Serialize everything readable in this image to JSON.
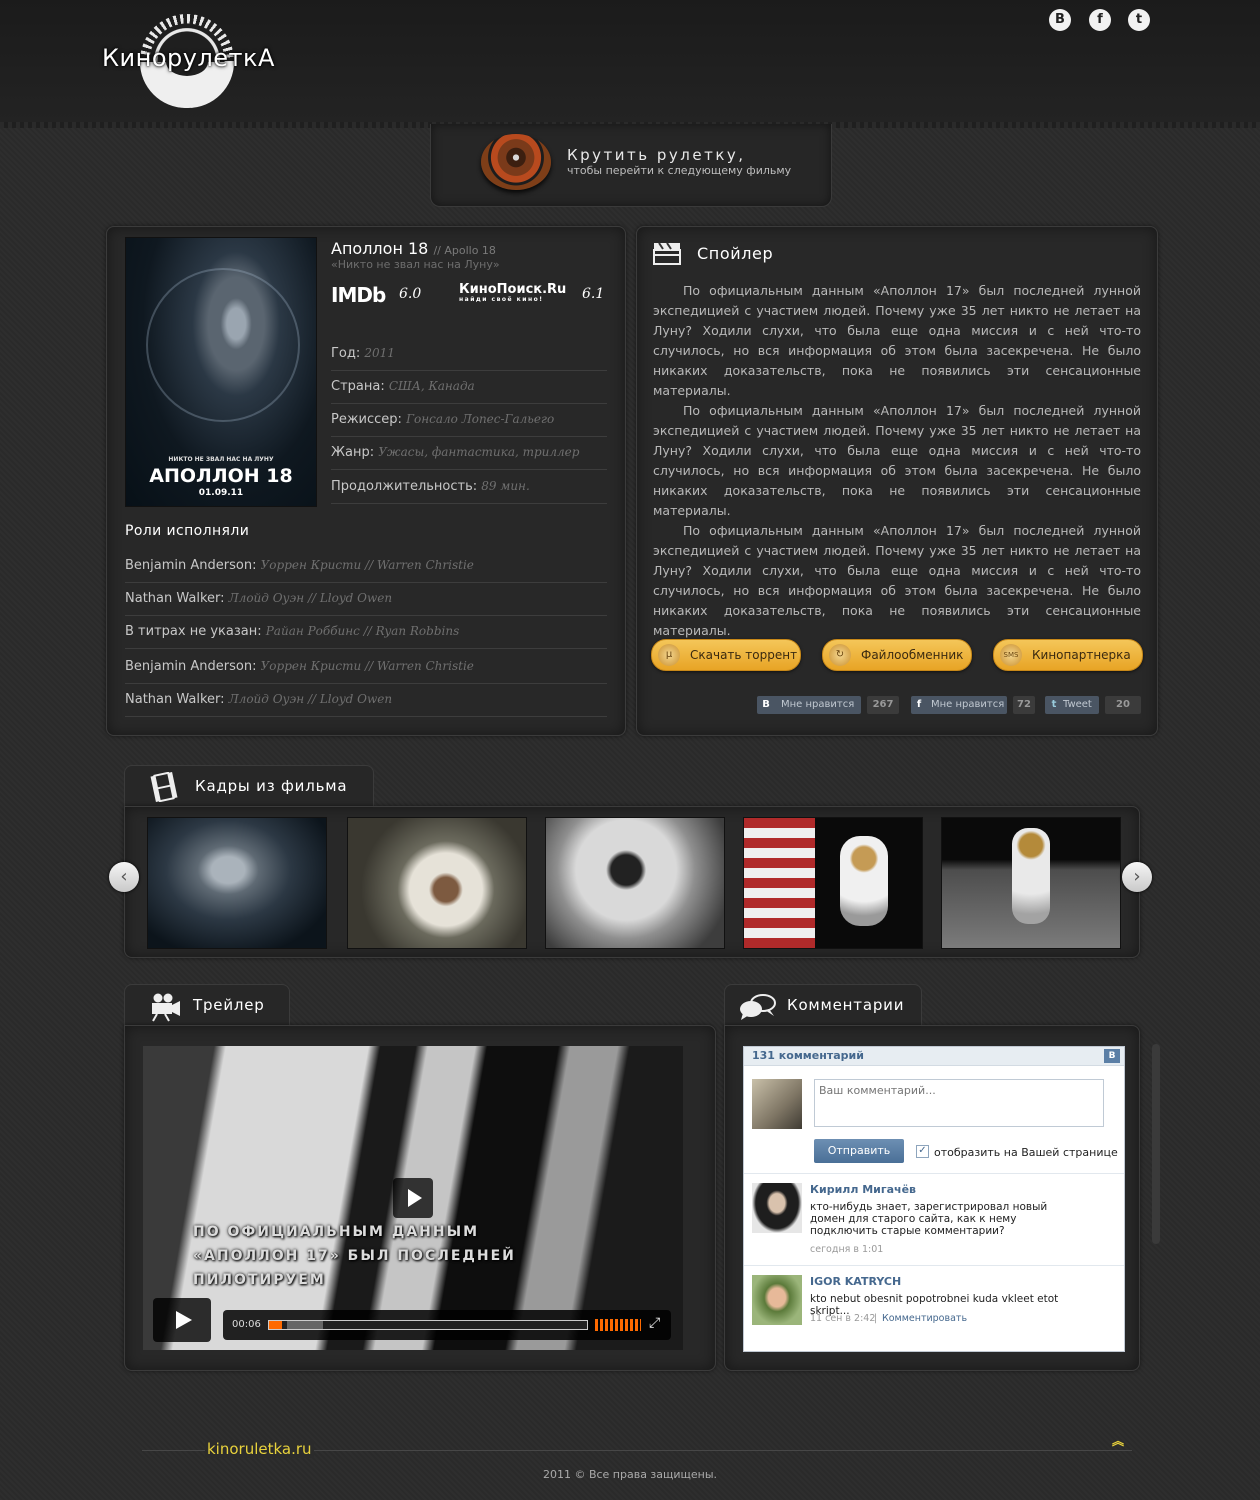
{
  "header": {
    "logo_text": "КинорулеткА",
    "social": [
      {
        "label": "В",
        "icon": "vk-icon"
      },
      {
        "label": "f",
        "icon": "facebook-icon"
      },
      {
        "label": "t",
        "icon": "twitter-icon"
      }
    ]
  },
  "roulette": {
    "title": "Крутить рулетку,",
    "subtitle": "чтобы перейти к следующему фильму"
  },
  "movie": {
    "title": "Аполлон 18",
    "original_title": "// Apollo 18",
    "tagline": "«Никто не звал нас на Луну»",
    "poster": {
      "tagline": "НИКТО НЕ ЗВАЛ НАС НА ЛУНУ",
      "title": "АПОЛЛОН 18",
      "date": "01.09.11"
    },
    "ratings": {
      "imdb_label": "IMDb",
      "imdb_value": "6.0",
      "kp_label": "КиноПоиск.Ru",
      "kp_sub": "найди своё кино!",
      "kp_value": "6.1"
    },
    "info": [
      {
        "label": "Год:",
        "value": "2011"
      },
      {
        "label": "Страна:",
        "value": "США, Канада"
      },
      {
        "label": "Режиссер:",
        "value": "Гонсало Лопес-Гальего"
      },
      {
        "label": "Жанр:",
        "value": "Ужасы, фантастика, триллер"
      },
      {
        "label": "Продолжительность:",
        "value": "89 мин."
      }
    ],
    "roles_title": "Роли исполняли",
    "cast": [
      {
        "role": "Benjamin Anderson:",
        "actor": "Уоррен Кристи // Warren Christie"
      },
      {
        "role": "Nathan Walker:",
        "actor": "Ллойд Оуэн // Lloyd Owen"
      },
      {
        "role": "В титрах не указан:",
        "actor": "Райан Роббинс // Ryan Robbins"
      },
      {
        "role": "Benjamin Anderson:",
        "actor": "Уоррен Кристи // Warren Christie"
      },
      {
        "role": "Nathan Walker:",
        "actor": "Ллойд Оуэн // Lloyd Owen"
      }
    ]
  },
  "spoiler": {
    "title": "Спойлер",
    "paragraphs": [
      "По официальным данным «Аполлон 17» был последней лунной экспедицией с участием людей. Почему уже 35 лет никто не летает на Луну? Ходили слухи, что была еще одна миссия и с ней что-то случилось, но вся информация об этом была засекречена. Не было никаких доказательств, пока не появились эти сенсационные материалы.",
      "По официальным данным «Аполлон 17» был последней лунной экспедицией с участием людей. Почему уже 35 лет никто не летает на Луну? Ходили слухи, что была еще одна миссия и с ней что-то случилось, но вся информация об этом была засекречена. Не было никаких доказательств, пока не появились эти сенсационные материалы.",
      "По официальным данным «Аполлон 17» был последней лунной экспедицией с участием людей. Почему уже 35 лет никто не летает на Луну? Ходили слухи, что была еще одна миссия и с ней что-то случилось, но вся информация об этом была засекречена. Не было никаких доказательств, пока не появились эти сенсационные материалы."
    ],
    "buttons": [
      {
        "label": "Скачать торрент",
        "icon": "torrent-icon"
      },
      {
        "label": "Файлообменник",
        "icon": "download-arrow-icon"
      },
      {
        "label": "Кинопартнерка",
        "icon": "sms-icon",
        "icon_text": "SMS"
      }
    ],
    "likes": [
      {
        "brand": "В",
        "label": "Мне нравится",
        "count": "267"
      },
      {
        "brand": "f",
        "label": "Мне нравится",
        "count": "72"
      },
      {
        "brand": "t",
        "label": "Tweet",
        "count": "20"
      }
    ]
  },
  "frames": {
    "title": "Кадры из фильма",
    "prev": "‹",
    "next": "›"
  },
  "trailer": {
    "title": "Трейлер",
    "subtitle_lines": [
      "ПО ОФИЦИАЛЬНЫМ ДАННЫМ",
      "«АПОЛЛОН 17» БЫЛ ПОСЛЕДНЕЙ",
      "ПИЛОТИРУЕМ"
    ],
    "time": "00:06",
    "progress": 0.04,
    "fullscreen_icon": "⤢"
  },
  "comments": {
    "title": "Комментарии",
    "count": "131 комментарий",
    "vk_logo": "В",
    "placeholder": "Ваш комментарий...",
    "send": "Отправить",
    "checkbox_label": "отобразить на Вашей странице",
    "checkbox_checked": true,
    "items": [
      {
        "name": "Кирилл Мигачёв",
        "text": "кто-нибудь знает, зарегистрировал новый домен для старого сайта, как к  нему подключить старые комментарии?",
        "date": "сегодня в 1:01",
        "reply": ""
      },
      {
        "name": "IGOR KATRYCH",
        "text": "kto nebut obesnit popotrobnei kuda vkleet etot skript...",
        "date": "11 сен в 2:42",
        "reply": "Комментировать"
      }
    ]
  },
  "footer": {
    "brand": "kinoruletka.ru",
    "up_icon": "︽",
    "copyright": "2011 © Все права защищены."
  }
}
